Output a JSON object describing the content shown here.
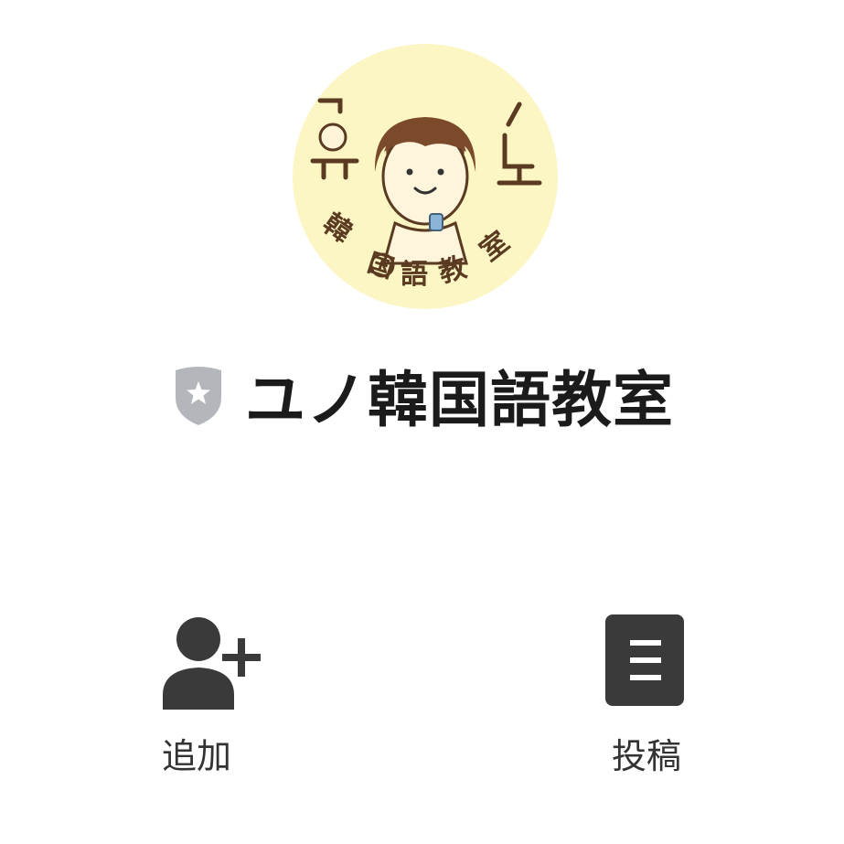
{
  "profile": {
    "account_name": "ユノ韓国語教室",
    "avatar": {
      "icon": "avatar-illustration",
      "background_color": "#fbf6c4",
      "artwork_text": [
        "유",
        "노",
        "韓国語教室"
      ]
    },
    "badge_icon": "verified-shield-star-icon",
    "badge_color": "#b3b6bb"
  },
  "actions": [
    {
      "label": "追加",
      "icon": "add-friend-icon",
      "color": "#3a3a3a"
    },
    {
      "label": "投稿",
      "icon": "posts-icon",
      "color": "#3a3a3a"
    }
  ]
}
